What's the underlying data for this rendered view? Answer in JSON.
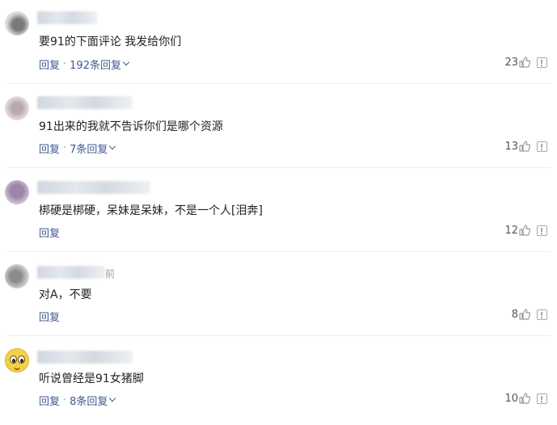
{
  "comments": [
    {
      "meta": "",
      "text": "要91的下面评论 我发给你们",
      "reply_label": "回复",
      "separator": "·",
      "replies_label": "192条回复",
      "likes": "23"
    },
    {
      "meta": "",
      "text": "91出来的我就不告诉你们是哪个资源",
      "reply_label": "回复",
      "separator": "·",
      "replies_label": "7条回复",
      "likes": "13"
    },
    {
      "meta": "",
      "text": "梆硬是梆硬，呆妹是呆妹，不是一个人[泪奔]",
      "reply_label": "回复",
      "likes": "12"
    },
    {
      "meta": "前",
      "text": "对A，不要",
      "reply_label": "回复",
      "likes": "8"
    },
    {
      "meta": "",
      "text": "听说曾经是91女猪脚",
      "reply_label": "回复",
      "separator": "·",
      "replies_label": "8条回复",
      "likes": "10"
    }
  ],
  "colors": {
    "link": "#405b8f",
    "muted": "#9aa0a6",
    "text": "#222222",
    "divider": "#ececec"
  },
  "icons": {
    "like": "thumbs-up-icon",
    "report": "report-icon",
    "expand": "chevron-down-icon"
  }
}
